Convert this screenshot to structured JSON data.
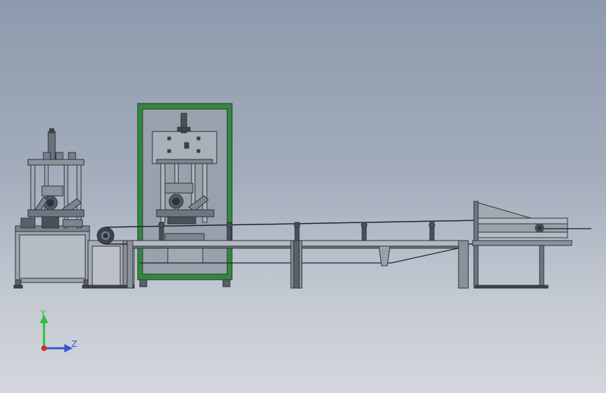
{
  "triad": {
    "y_label": "Y",
    "z_label": "Z",
    "colors": {
      "y": "#2fbf3a",
      "z": "#2f57d6",
      "x": "#d62a2a"
    }
  },
  "colors": {
    "background_top": "#8d9aad",
    "background_bottom": "#d3d7dd",
    "cabinet_green": "#2f8a3a",
    "frame_steel": "#6f7682",
    "frame_dark": "#3d434c",
    "panel_grey": "#9aa1ac"
  },
  "components": [
    "winding-machine-left",
    "motor-pulley",
    "enclosed-cabinet-machine",
    "conveyor-line",
    "discharge-rack"
  ]
}
